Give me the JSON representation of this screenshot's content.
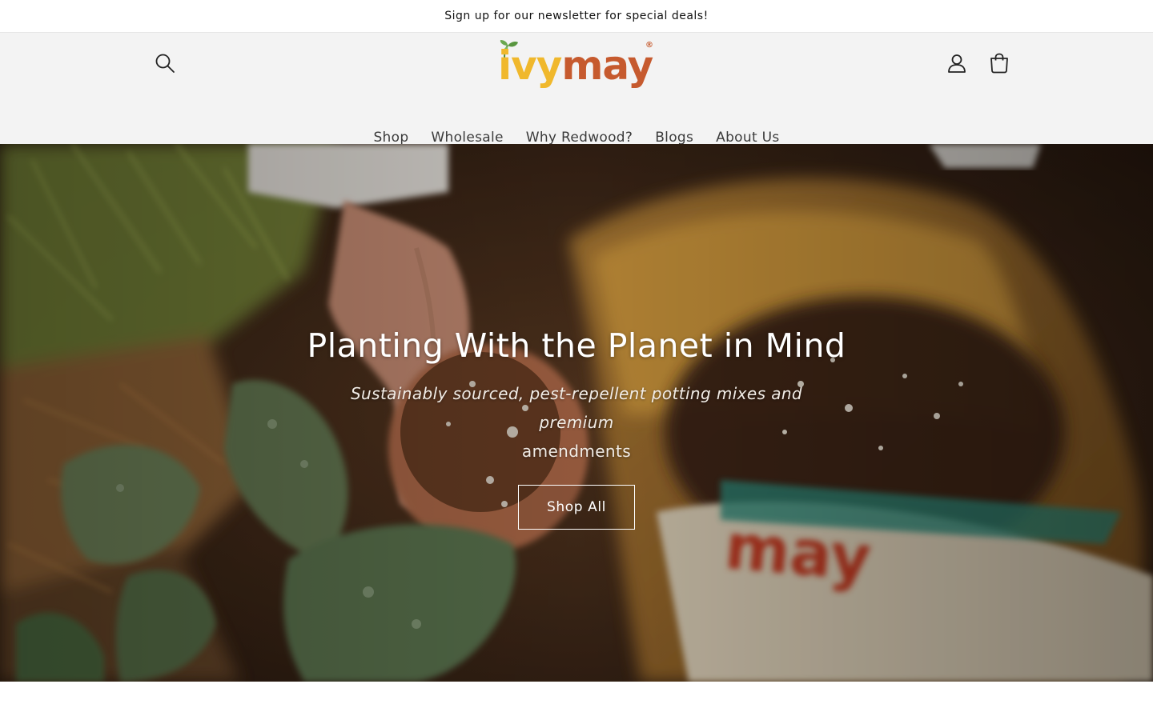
{
  "announcement": {
    "text": "Sign up for our newsletter for special deals!"
  },
  "header": {
    "logo": {
      "part1": "ivy",
      "part2": "may",
      "reg": "®"
    },
    "icons": {
      "search": "search-icon",
      "account": "user-icon",
      "cart": "cart-icon"
    }
  },
  "nav": {
    "items": [
      {
        "label": "Shop"
      },
      {
        "label": "Wholesale"
      },
      {
        "label": "Why Redwood?"
      },
      {
        "label": "Blogs"
      },
      {
        "label": "About Us"
      }
    ]
  },
  "hero": {
    "title": "Planting With the Planet in Mind",
    "subtitle_line1": "Sustainably sourced, pest-repellent potting mixes and premium",
    "subtitle_line2": "amendments",
    "cta": "Shop All"
  },
  "colors": {
    "header_bg": "#f3f3f3",
    "logo_ivy": "#f0b82c",
    "logo_may": "#c65a2e",
    "hero_text": "#ffffff"
  }
}
